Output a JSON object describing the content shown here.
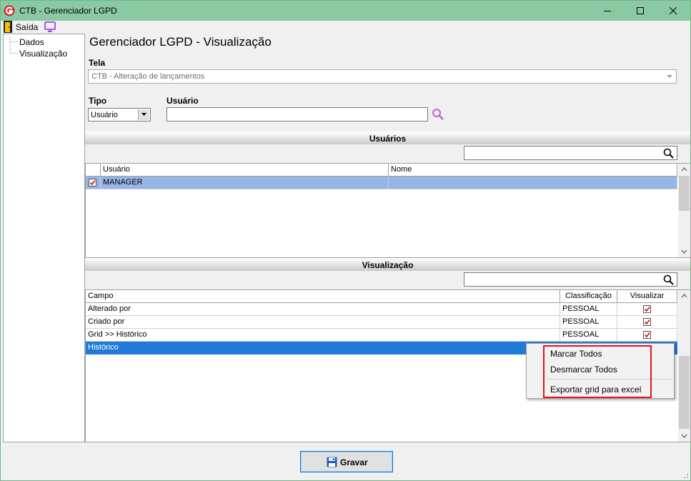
{
  "window": {
    "title": "CTB - Gerenciador LGPD"
  },
  "menubar": {
    "exit_label": "Saída"
  },
  "tree": {
    "items": [
      {
        "label": "Dados"
      },
      {
        "label": "Visualização"
      }
    ]
  },
  "page": {
    "title": "Gerenciador LGPD - Visualização"
  },
  "form": {
    "tela_label": "Tela",
    "tela_value": "CTB - Alteração de lançamentos",
    "tipo_label": "Tipo",
    "tipo_value": "Usuário",
    "usuario_label": "Usuário",
    "usuario_value": ""
  },
  "users_section": {
    "header": "Usuários",
    "filter_value": "",
    "columns": [
      "Usuário",
      "Nome"
    ],
    "rows": [
      {
        "checked": true,
        "usuario": "MANAGER",
        "nome": ""
      }
    ]
  },
  "view_section": {
    "header": "Visualização",
    "filter_value": "",
    "columns": [
      "Campo",
      "Classificação",
      "Visualizar"
    ],
    "rows": [
      {
        "campo": "Alterado por",
        "classificacao": "PESSOAL",
        "visualizar": true
      },
      {
        "campo": "Criado por",
        "classificacao": "PESSOAL",
        "visualizar": true
      },
      {
        "campo": "Grid >> Histórico",
        "classificacao": "PESSOAL",
        "visualizar": true
      },
      {
        "campo": "Histórico",
        "classificacao": "",
        "visualizar": null
      }
    ]
  },
  "context_menu": {
    "items": [
      "Marcar Todos",
      "Desmarcar Todos",
      "Exportar grid para excel"
    ]
  },
  "footer": {
    "save_label": "Gravar"
  },
  "colors": {
    "titlebar": "#8bc9a2",
    "selected_row_light": "#97b6e8",
    "selected_row_dark": "#1f7bd7",
    "highlight_box": "#e0141e",
    "check_red": "#d21e1e"
  }
}
